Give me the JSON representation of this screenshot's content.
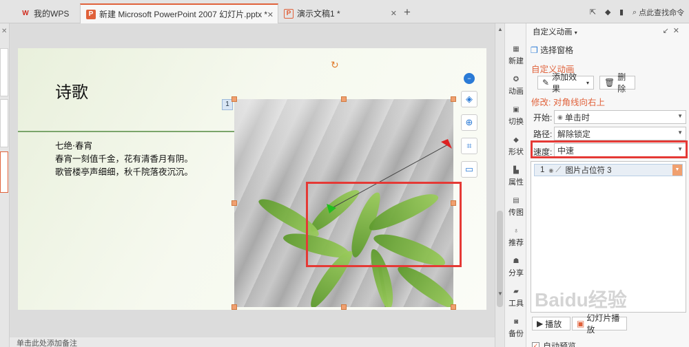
{
  "tabs": [
    {
      "label": "我的WPS",
      "icon": "wps-logo-icon",
      "active": false
    },
    {
      "label": "新建 Microsoft PowerPoint 2007 幻灯片.pptx *",
      "icon": "ppt-file-icon",
      "active": true
    },
    {
      "label": "演示文稿1 *",
      "icon": "doc-file-icon",
      "active": false
    }
  ],
  "toolbar_right": {
    "search_placeholder": "点此查找命令"
  },
  "slide": {
    "title": "诗歌",
    "poem_lines": [
      "七绝·春宵",
      "春宵一刻值千金，花有清香月有阴。",
      "歌管楼亭声细细，秋千院落夜沉沉。"
    ],
    "order_badge": "1"
  },
  "notes": {
    "placeholder": "单击此处添加备注"
  },
  "right_strip": [
    {
      "label": "新建",
      "icon": "new-icon"
    },
    {
      "label": "动画",
      "icon": "animation-icon"
    },
    {
      "label": "切换",
      "icon": "transition-icon"
    },
    {
      "label": "形状",
      "icon": "shape-icon"
    },
    {
      "label": "属性",
      "icon": "property-icon"
    },
    {
      "label": "传图",
      "icon": "upload-image-icon"
    },
    {
      "label": "推荐",
      "icon": "recommend-icon"
    },
    {
      "label": "分享",
      "icon": "share-icon"
    },
    {
      "label": "工具",
      "icon": "tools-icon"
    },
    {
      "label": "备份",
      "icon": "backup-icon"
    }
  ],
  "pane": {
    "title": "自定义动画",
    "selection_pane": "选择窗格",
    "section_title": "自定义动画",
    "add_effect": "添加效果",
    "delete": "删除",
    "modify_title": "修改: 对角线向右上",
    "start_label": "开始:",
    "start_value": "单击时",
    "path_label": "路径:",
    "path_value": "解除锁定",
    "speed_label": "速度:",
    "speed_value": "中速",
    "list_item_index": "1",
    "list_item_text": "图片占位符 3",
    "auto_preview": "自动预览",
    "play_btn": "播放",
    "slideshow_btn": "幻灯片播放"
  },
  "watermark": "Baidu经验"
}
